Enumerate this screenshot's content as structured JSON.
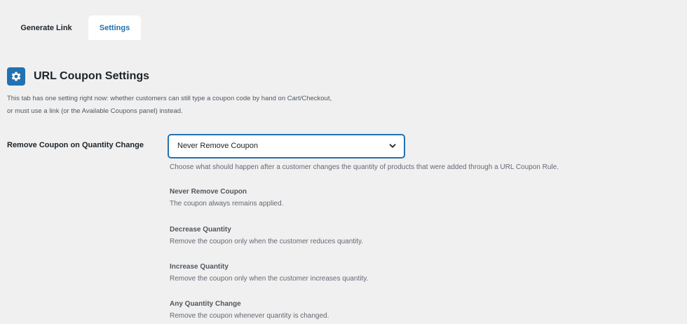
{
  "tabs": [
    {
      "label": "Generate Link",
      "active": false
    },
    {
      "label": "Settings",
      "active": true
    }
  ],
  "section": {
    "icon": "gear-icon",
    "title": "URL Coupon Settings",
    "intro_line1": "This tab has one setting right now: whether customers can still type a coupon code by hand on Cart/Checkout,",
    "intro_line2": "or must use a link (or the Available Coupons panel) instead."
  },
  "field": {
    "label": "Remove Coupon on Quantity Change",
    "selected": "Never Remove Coupon",
    "help": "Choose what should happen after a customer changes the quantity of products that were added through a URL Coupon Rule."
  },
  "options": [
    {
      "title": "Never Remove Coupon",
      "desc": "The coupon always remains applied."
    },
    {
      "title": "Decrease Quantity",
      "desc": "Remove the coupon only when the customer reduces quantity."
    },
    {
      "title": "Increase Quantity",
      "desc": "Remove the coupon only when the customer increases quantity."
    },
    {
      "title": "Any Quantity Change",
      "desc": "Remove the coupon whenever quantity is changed."
    }
  ],
  "colors": {
    "accent": "#2271b1",
    "background": "#f0f0f1"
  }
}
